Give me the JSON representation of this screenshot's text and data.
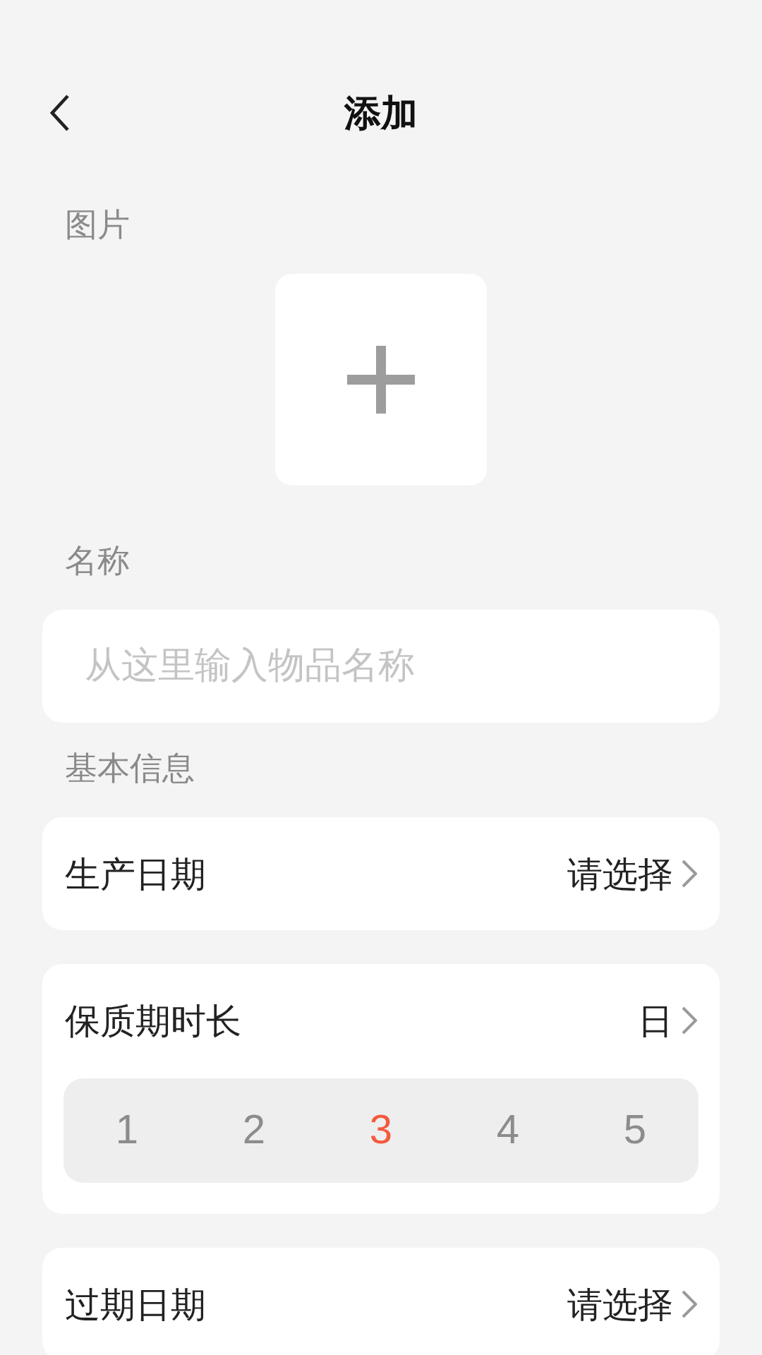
{
  "header": {
    "title": "添加"
  },
  "image_section": {
    "label": "图片"
  },
  "name_section": {
    "label": "名称",
    "placeholder": "从这里输入物品名称"
  },
  "basic_info": {
    "label": "基本信息"
  },
  "rows": [
    {
      "kind": "select",
      "label": "生产日期",
      "value": "请选择"
    },
    {
      "kind": "duration",
      "label": "保质期时长",
      "value": "日",
      "options": [
        {
          "label": "1",
          "selected": false
        },
        {
          "label": "2",
          "selected": false
        },
        {
          "label": "3",
          "selected": true
        },
        {
          "label": "4",
          "selected": false
        },
        {
          "label": "5",
          "selected": false
        }
      ]
    },
    {
      "kind": "select",
      "label": "过期日期",
      "value": "请选择"
    }
  ]
}
